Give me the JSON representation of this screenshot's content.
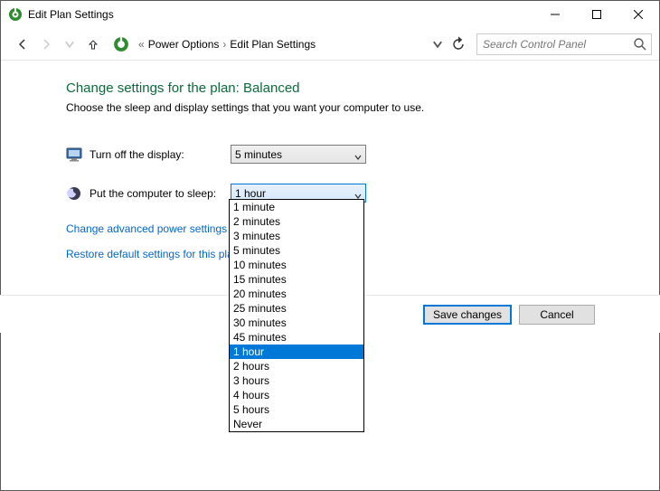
{
  "window": {
    "title": "Edit Plan Settings"
  },
  "breadcrumb": {
    "sep": "«",
    "item1": "Power Options",
    "chev": "›",
    "item2": "Edit Plan Settings"
  },
  "search": {
    "placeholder": "Search Control Panel"
  },
  "heading": "Change settings for the plan: Balanced",
  "subheading": "Choose the sleep and display settings that you want your computer to use.",
  "settings": {
    "display_label": "Turn off the display:",
    "display_value": "5 minutes",
    "sleep_label": "Put the computer to sleep:",
    "sleep_value": "1 hour"
  },
  "links": {
    "advanced": "Change advanced power settings",
    "restore": "Restore default settings for this plan"
  },
  "buttons": {
    "save": "Save changes",
    "cancel": "Cancel"
  },
  "dropdown": {
    "options": [
      "1 minute",
      "2 minutes",
      "3 minutes",
      "5 minutes",
      "10 minutes",
      "15 minutes",
      "20 minutes",
      "25 minutes",
      "30 minutes",
      "45 minutes",
      "1 hour",
      "2 hours",
      "3 hours",
      "4 hours",
      "5 hours",
      "Never"
    ],
    "selected": "1 hour"
  }
}
